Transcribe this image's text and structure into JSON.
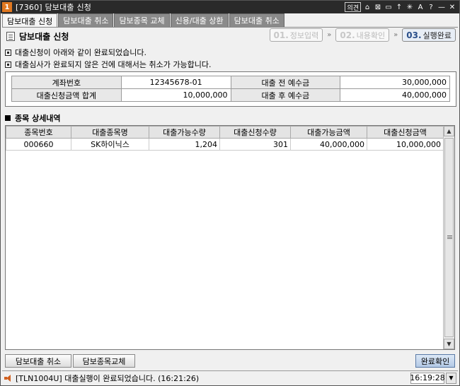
{
  "window": {
    "number": "1",
    "title": "[7360] 담보대출 신청",
    "title_buttons": [
      "의견",
      "⌂",
      "⊠",
      "▭",
      "↑",
      "✳",
      "A",
      "?",
      "—",
      "✕"
    ]
  },
  "tabs": [
    {
      "label": "담보대출 신청",
      "active": true
    },
    {
      "label": "담보대출 취소",
      "active": false
    },
    {
      "label": "담보종목 교체",
      "active": false
    },
    {
      "label": "신용/대출 상환",
      "active": false
    },
    {
      "label": "담보대출 취소",
      "active": false
    }
  ],
  "header": {
    "title": "담보대출 신청",
    "steps": [
      {
        "num": "01.",
        "label": "정보입력",
        "done": false
      },
      {
        "num": "02.",
        "label": "내용확인",
        "done": false
      },
      {
        "num": "03.",
        "label": "실행완료",
        "done": true
      }
    ],
    "arrow": "»"
  },
  "messages": [
    "대출신청이 아래와 같이 완료되었습니다.",
    "대출심사가 완료되지 않은 건에 대해서는 취소가 가능합니다."
  ],
  "summary": {
    "account_label": "계좌번호",
    "account_value": "12345678-01",
    "pre_deposit_label": "대출 전 예수금",
    "pre_deposit_value": "30,000,000",
    "total_label": "대출신청금액 합계",
    "total_value": "10,000,000",
    "post_deposit_label": "대출 후 예수금",
    "post_deposit_value": "40,000,000"
  },
  "detail": {
    "title": "종목 상세내역",
    "columns": [
      "종목번호",
      "대출종목명",
      "대출가능수량",
      "대출신청수량",
      "대출가능금액",
      "대출신청금액"
    ],
    "rows": [
      [
        "000660",
        "SK하이닉스",
        "1,204",
        "301",
        "40,000,000",
        "10,000,000"
      ]
    ]
  },
  "buttons": {
    "cancel_loan": "담보대출 취소",
    "replace_collateral": "담보종목교체",
    "confirm": "완료확인"
  },
  "status": {
    "message": "[TLN1004U] 대출실행이 완료되었습니다. (16:21:26)",
    "time": "16:19:28"
  }
}
